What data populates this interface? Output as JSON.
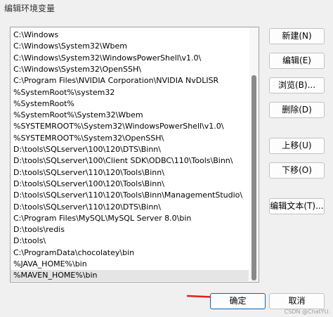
{
  "window": {
    "title": "编辑环境变量"
  },
  "path_list": {
    "items": [
      "C:\\Windows",
      "C:\\Windows\\System32\\Wbem",
      "C:\\Windows\\System32\\WindowsPowerShell\\v1.0\\",
      "C:\\Windows\\System32\\OpenSSH\\",
      "C:\\Program Files\\NVIDIA Corporation\\NVIDIA NvDLISR",
      "%SystemRoot%\\system32",
      "%SystemRoot%",
      "%SystemRoot%\\System32\\Wbem",
      "%SYSTEMROOT%\\System32\\WindowsPowerShell\\v1.0\\",
      "%SYSTEMROOT%\\System32\\OpenSSH\\",
      "D:\\tools\\SQLserver\\100\\120\\DTS\\Binn\\",
      "D:\\tools\\SQLserver\\100\\Client SDK\\ODBC\\110\\Tools\\Binn\\",
      "D:\\tools\\SQLserver\\110\\120\\Tools\\Binn\\",
      "D:\\tools\\SQLserver\\100\\120\\Tools\\Binn\\",
      "D:\\tools\\SQLserver\\110\\120\\Tools\\Binn\\ManagementStudio\\",
      "D:\\tools\\SQLserver\\110\\120\\DTS\\Binn\\",
      "C:\\Program Files\\MySQL\\MySQL Server 8.0\\bin",
      "D:\\tools\\redis",
      "D:\\tools\\",
      "C:\\ProgramData\\chocolatey\\bin",
      "%JAVA_HOME%\\bin",
      "%MAVEN_HOME%\\bin"
    ],
    "selected_index": 21
  },
  "buttons": {
    "new": "新建(N)",
    "edit": "编辑(E)",
    "browse": "浏览(B)...",
    "delete": "删除(D)",
    "move_up": "上移(U)",
    "move_down": "下移(O)",
    "edit_text": "编辑文本(T)...",
    "ok": "确定",
    "cancel": "取消"
  },
  "annotation": {
    "arrow_color": "#e02020"
  },
  "watermark": "CSDN @ChatYU."
}
